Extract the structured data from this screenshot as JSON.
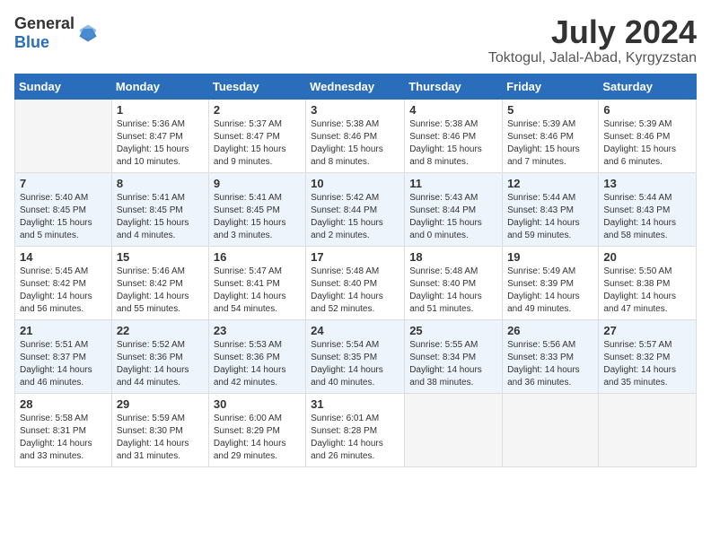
{
  "header": {
    "logo_general": "General",
    "logo_blue": "Blue",
    "month": "July 2024",
    "location": "Toktogul, Jalal-Abad, Kyrgyzstan"
  },
  "weekdays": [
    "Sunday",
    "Monday",
    "Tuesday",
    "Wednesday",
    "Thursday",
    "Friday",
    "Saturday"
  ],
  "weeks": [
    [
      {
        "day": "",
        "sunrise": "",
        "sunset": "",
        "daylight": "",
        "empty": true
      },
      {
        "day": "1",
        "sunrise": "Sunrise: 5:36 AM",
        "sunset": "Sunset: 8:47 PM",
        "daylight": "Daylight: 15 hours and 10 minutes."
      },
      {
        "day": "2",
        "sunrise": "Sunrise: 5:37 AM",
        "sunset": "Sunset: 8:47 PM",
        "daylight": "Daylight: 15 hours and 9 minutes."
      },
      {
        "day": "3",
        "sunrise": "Sunrise: 5:38 AM",
        "sunset": "Sunset: 8:46 PM",
        "daylight": "Daylight: 15 hours and 8 minutes."
      },
      {
        "day": "4",
        "sunrise": "Sunrise: 5:38 AM",
        "sunset": "Sunset: 8:46 PM",
        "daylight": "Daylight: 15 hours and 8 minutes."
      },
      {
        "day": "5",
        "sunrise": "Sunrise: 5:39 AM",
        "sunset": "Sunset: 8:46 PM",
        "daylight": "Daylight: 15 hours and 7 minutes."
      },
      {
        "day": "6",
        "sunrise": "Sunrise: 5:39 AM",
        "sunset": "Sunset: 8:46 PM",
        "daylight": "Daylight: 15 hours and 6 minutes."
      }
    ],
    [
      {
        "day": "7",
        "sunrise": "Sunrise: 5:40 AM",
        "sunset": "Sunset: 8:45 PM",
        "daylight": "Daylight: 15 hours and 5 minutes."
      },
      {
        "day": "8",
        "sunrise": "Sunrise: 5:41 AM",
        "sunset": "Sunset: 8:45 PM",
        "daylight": "Daylight: 15 hours and 4 minutes."
      },
      {
        "day": "9",
        "sunrise": "Sunrise: 5:41 AM",
        "sunset": "Sunset: 8:45 PM",
        "daylight": "Daylight: 15 hours and 3 minutes."
      },
      {
        "day": "10",
        "sunrise": "Sunrise: 5:42 AM",
        "sunset": "Sunset: 8:44 PM",
        "daylight": "Daylight: 15 hours and 2 minutes."
      },
      {
        "day": "11",
        "sunrise": "Sunrise: 5:43 AM",
        "sunset": "Sunset: 8:44 PM",
        "daylight": "Daylight: 15 hours and 0 minutes."
      },
      {
        "day": "12",
        "sunrise": "Sunrise: 5:44 AM",
        "sunset": "Sunset: 8:43 PM",
        "daylight": "Daylight: 14 hours and 59 minutes."
      },
      {
        "day": "13",
        "sunrise": "Sunrise: 5:44 AM",
        "sunset": "Sunset: 8:43 PM",
        "daylight": "Daylight: 14 hours and 58 minutes."
      }
    ],
    [
      {
        "day": "14",
        "sunrise": "Sunrise: 5:45 AM",
        "sunset": "Sunset: 8:42 PM",
        "daylight": "Daylight: 14 hours and 56 minutes."
      },
      {
        "day": "15",
        "sunrise": "Sunrise: 5:46 AM",
        "sunset": "Sunset: 8:42 PM",
        "daylight": "Daylight: 14 hours and 55 minutes."
      },
      {
        "day": "16",
        "sunrise": "Sunrise: 5:47 AM",
        "sunset": "Sunset: 8:41 PM",
        "daylight": "Daylight: 14 hours and 54 minutes."
      },
      {
        "day": "17",
        "sunrise": "Sunrise: 5:48 AM",
        "sunset": "Sunset: 8:40 PM",
        "daylight": "Daylight: 14 hours and 52 minutes."
      },
      {
        "day": "18",
        "sunrise": "Sunrise: 5:48 AM",
        "sunset": "Sunset: 8:40 PM",
        "daylight": "Daylight: 14 hours and 51 minutes."
      },
      {
        "day": "19",
        "sunrise": "Sunrise: 5:49 AM",
        "sunset": "Sunset: 8:39 PM",
        "daylight": "Daylight: 14 hours and 49 minutes."
      },
      {
        "day": "20",
        "sunrise": "Sunrise: 5:50 AM",
        "sunset": "Sunset: 8:38 PM",
        "daylight": "Daylight: 14 hours and 47 minutes."
      }
    ],
    [
      {
        "day": "21",
        "sunrise": "Sunrise: 5:51 AM",
        "sunset": "Sunset: 8:37 PM",
        "daylight": "Daylight: 14 hours and 46 minutes."
      },
      {
        "day": "22",
        "sunrise": "Sunrise: 5:52 AM",
        "sunset": "Sunset: 8:36 PM",
        "daylight": "Daylight: 14 hours and 44 minutes."
      },
      {
        "day": "23",
        "sunrise": "Sunrise: 5:53 AM",
        "sunset": "Sunset: 8:36 PM",
        "daylight": "Daylight: 14 hours and 42 minutes."
      },
      {
        "day": "24",
        "sunrise": "Sunrise: 5:54 AM",
        "sunset": "Sunset: 8:35 PM",
        "daylight": "Daylight: 14 hours and 40 minutes."
      },
      {
        "day": "25",
        "sunrise": "Sunrise: 5:55 AM",
        "sunset": "Sunset: 8:34 PM",
        "daylight": "Daylight: 14 hours and 38 minutes."
      },
      {
        "day": "26",
        "sunrise": "Sunrise: 5:56 AM",
        "sunset": "Sunset: 8:33 PM",
        "daylight": "Daylight: 14 hours and 36 minutes."
      },
      {
        "day": "27",
        "sunrise": "Sunrise: 5:57 AM",
        "sunset": "Sunset: 8:32 PM",
        "daylight": "Daylight: 14 hours and 35 minutes."
      }
    ],
    [
      {
        "day": "28",
        "sunrise": "Sunrise: 5:58 AM",
        "sunset": "Sunset: 8:31 PM",
        "daylight": "Daylight: 14 hours and 33 minutes."
      },
      {
        "day": "29",
        "sunrise": "Sunrise: 5:59 AM",
        "sunset": "Sunset: 8:30 PM",
        "daylight": "Daylight: 14 hours and 31 minutes."
      },
      {
        "day": "30",
        "sunrise": "Sunrise: 6:00 AM",
        "sunset": "Sunset: 8:29 PM",
        "daylight": "Daylight: 14 hours and 29 minutes."
      },
      {
        "day": "31",
        "sunrise": "Sunrise: 6:01 AM",
        "sunset": "Sunset: 8:28 PM",
        "daylight": "Daylight: 14 hours and 26 minutes."
      },
      {
        "day": "",
        "sunrise": "",
        "sunset": "",
        "daylight": "",
        "empty": true
      },
      {
        "day": "",
        "sunrise": "",
        "sunset": "",
        "daylight": "",
        "empty": true
      },
      {
        "day": "",
        "sunrise": "",
        "sunset": "",
        "daylight": "",
        "empty": true
      }
    ]
  ]
}
